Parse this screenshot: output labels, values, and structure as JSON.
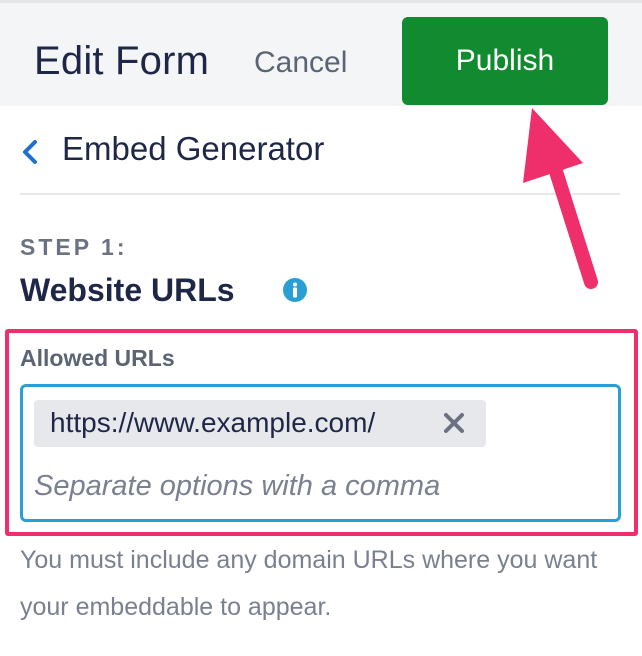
{
  "header": {
    "title": "Edit Form",
    "cancel_label": "Cancel",
    "publish_label": "Publish"
  },
  "nav": {
    "back_label": "Embed Generator"
  },
  "step": {
    "label": "STEP 1:",
    "title": "Website URLs"
  },
  "allowed_urls": {
    "label": "Allowed URLs",
    "tags": [
      "https://www.example.com/"
    ],
    "placeholder": "Separate options with a comma"
  },
  "help_text": "You must include any domain URLs where you want your embeddable to appear.",
  "colors": {
    "publish": "#128a2f",
    "accent_blue": "#2a9fd6",
    "annotation_pink": "#ee2f6b"
  },
  "icons": {
    "back": "chevron-left-icon",
    "info": "info-icon",
    "remove": "close-icon"
  }
}
